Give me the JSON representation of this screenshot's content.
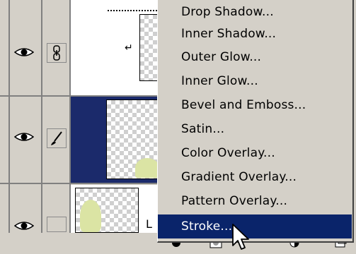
{
  "menu": {
    "items": [
      {
        "label": "Drop Shadow..."
      },
      {
        "label": "Inner Shadow..."
      },
      {
        "label": "Outer Glow..."
      },
      {
        "label": "Inner Glow..."
      },
      {
        "label": "Bevel and Emboss..."
      },
      {
        "label": "Satin..."
      },
      {
        "label": "Color Overlay..."
      },
      {
        "label": "Gradient Overlay..."
      },
      {
        "label": "Pattern Overlay..."
      },
      {
        "label": "Stroke..."
      }
    ],
    "active_index": 9,
    "highlight_color": "#0a246a"
  },
  "layers": {
    "selected_row_color": "#1b2a6b",
    "bottom_row_label": "L"
  },
  "icons": {
    "visibility": "eye-icon",
    "link": "chain-link-icon",
    "brush": "brush-icon",
    "clip": "clipping-arrow-icon",
    "cursor": "arrow-cursor-icon"
  }
}
